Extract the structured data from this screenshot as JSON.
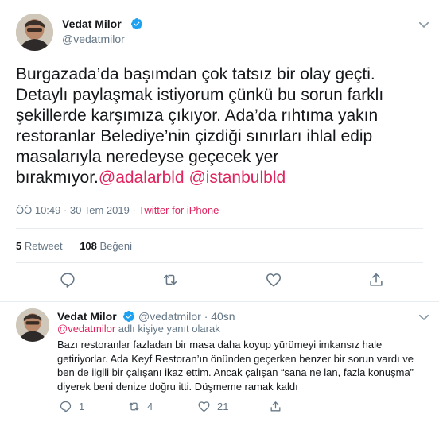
{
  "tweet": {
    "author_name": "Vedat Milor",
    "author_handle": "@vedatmilor",
    "text_main": "Burgazada’da başımdan çok tatsız bir olay geçti. Detaylı paylaşmak istiyorum çünkü bu sorun farklı şekillerde karşımıza çıkıyor. Ada’da rıhtıma yakın restoranlar Belediye’nin çizdiği sınırları ihlal edip masalarıyla neredeyse geçecek yer bırakmıyor.",
    "mention_1": "@adalarbld",
    "mention_2": "@istanbulbld",
    "timestamp": "ÖÖ 10:49 · 30 Tem 2019 ·",
    "source": "Twitter for iPhone",
    "retweet_count": "5",
    "retweet_label": "Retweet",
    "like_count": "108",
    "like_label": "Beğeni"
  },
  "reply": {
    "author_name": "Vedat Milor",
    "author_handle": "@vedatmilor",
    "time": "· 40sn",
    "replying_to_handle": "@vedatmilor",
    "replying_to_suffix": "adlı kişiye yanıt olarak",
    "text": "Bazı restoranlar fazladan bir masa daha koyup yürümeyi imkansız hale getiriyorlar. Ada Keyf Restoran’ın önünden geçerken benzer bir sorun vardı ve ben de ilgili bir çalışanı ikaz ettim. Ancak çalışan “sana ne lan, fazla konuşma” diyerek beni denize doğru itti. Düşmeme ramak kaldı",
    "reply_count": "1",
    "retweet_count": "4",
    "like_count": "21"
  },
  "colors": {
    "accent": "#e0245e",
    "muted": "#657786",
    "verified": "#1da1f2"
  }
}
